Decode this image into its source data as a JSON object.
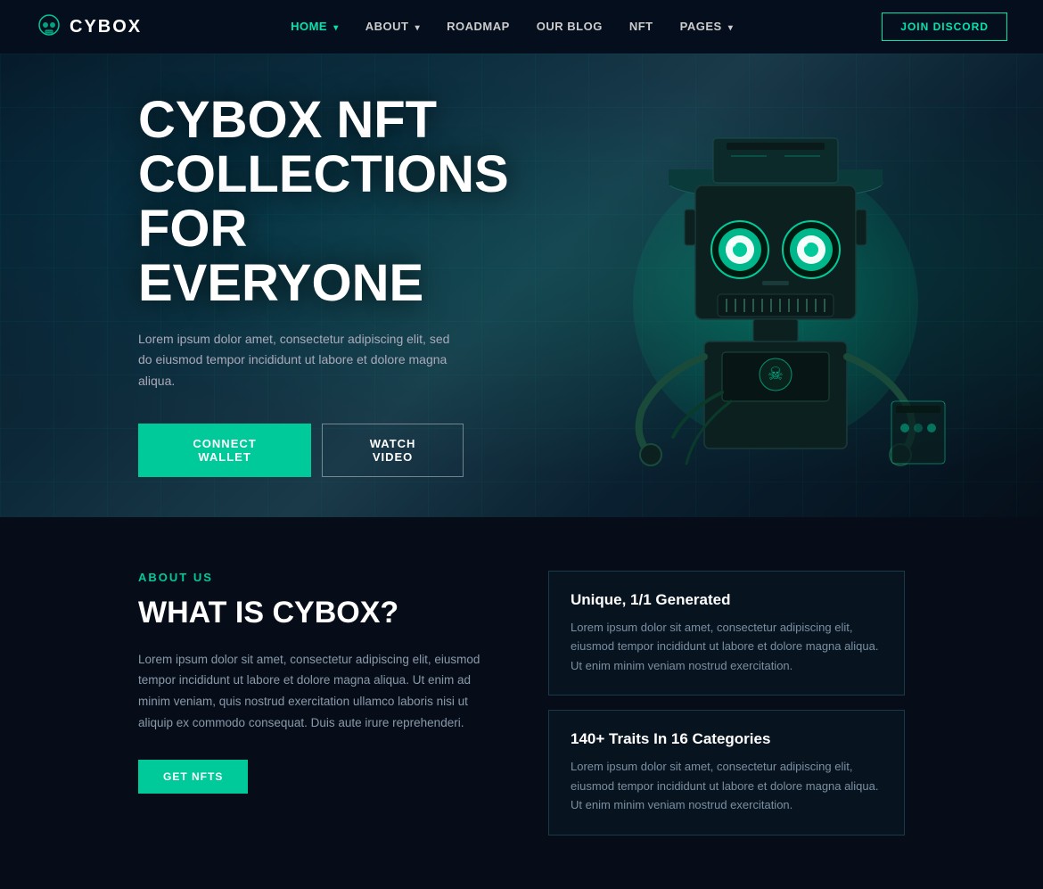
{
  "brand": {
    "name": "CYBOX",
    "logo_alt": "Cybox skull logo"
  },
  "navbar": {
    "join_discord_label": "JOIN DISCORD",
    "links": [
      {
        "label": "HOME",
        "active": true,
        "has_dropdown": true
      },
      {
        "label": "ABOUT",
        "active": false,
        "has_dropdown": true
      },
      {
        "label": "ROADMAP",
        "active": false,
        "has_dropdown": false
      },
      {
        "label": "OUR BLOG",
        "active": false,
        "has_dropdown": false
      },
      {
        "label": "NFT",
        "active": false,
        "has_dropdown": false
      },
      {
        "label": "PAGES",
        "active": false,
        "has_dropdown": true
      }
    ]
  },
  "hero": {
    "title": "CYBOX NFT COLLECTIONS FOR EVERYONE",
    "description": "Lorem ipsum dolor amet, consectetur adipiscing elit, sed do eiusmod tempor incididunt ut labore et dolore magna aliqua.",
    "connect_wallet_label": "CONNECT WALLET",
    "watch_video_label": "WATCH VIDEO"
  },
  "about": {
    "section_label": "ABOUT US",
    "title": "WHAT IS CYBOX?",
    "description": "Lorem ipsum dolor sit amet, consectetur adipiscing elit, eiusmod tempor incididunt ut labore et dolore magna aliqua. Ut enim ad minim veniam, quis nostrud exercitation ullamco laboris nisi ut aliquip ex commodo consequat. Duis aute irure reprehenderi.",
    "get_nfts_label": "GET NFTS",
    "features": [
      {
        "title": "Unique, 1/1 Generated",
        "text": "Lorem ipsum dolor sit amet, consectetur adipiscing elit, eiusmod tempor incididunt ut labore et dolore magna aliqua. Ut enim minim veniam nostrud exercitation."
      },
      {
        "title": "140+ Traits In 16 Categories",
        "text": "Lorem ipsum dolor sit amet, consectetur adipiscing elit, eiusmod tempor incididunt ut labore et dolore magna aliqua. Ut enim minim veniam nostrud exercitation."
      }
    ]
  },
  "colors": {
    "accent": "#00c99a",
    "bg_dark": "#060d18",
    "bg_hero": "#0a1a28",
    "border": "#1a3a4a"
  }
}
